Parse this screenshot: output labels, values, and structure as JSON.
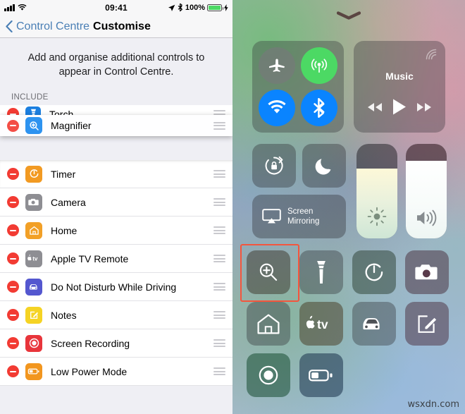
{
  "status_bar": {
    "signal_icon": "cellular-bars-icon",
    "wifi_icon": "wifi-icon",
    "time": "09:41",
    "location_icon": "location-arrow-icon",
    "bluetooth_icon": "bluetooth-icon",
    "battery_percent": "100%",
    "battery_icon": "battery-full-icon",
    "charging_icon": "charging-bolt-icon",
    "battery_color": "#4cd964"
  },
  "nav_bar": {
    "back_icon": "chevron-left-icon",
    "back_label": "Control Centre",
    "title": "Customise",
    "back_color": "#4a7fb5"
  },
  "intro_text": "Add and organise additional controls to appear in Control Centre.",
  "include_section": {
    "header": "INCLUDE",
    "items": [
      {
        "label": "Torch",
        "icon": "torch-icon",
        "icon_color": "#1b7fe0",
        "remove_icon": "minus-circle-icon",
        "reorder_icon": "reorder-grip-icon",
        "state": "static"
      },
      {
        "label": "Magnifier",
        "icon": "magnifier-icon",
        "icon_color": "#2d93f0",
        "remove_icon": "minus-circle-icon",
        "reorder_icon": "reorder-grip-icon",
        "state": "dragging"
      },
      {
        "label": "Timer",
        "icon": "timer-icon",
        "icon_color": "#f29a22",
        "remove_icon": "minus-circle-icon",
        "reorder_icon": "reorder-grip-icon",
        "state": "static"
      },
      {
        "label": "Camera",
        "icon": "camera-icon",
        "icon_color": "#8e8e93",
        "remove_icon": "minus-circle-icon",
        "reorder_icon": "reorder-grip-icon",
        "state": "static"
      },
      {
        "label": "Home",
        "icon": "home-icon",
        "icon_color": "#f2a027",
        "remove_icon": "minus-circle-icon",
        "reorder_icon": "reorder-grip-icon",
        "state": "static"
      },
      {
        "label": "Apple TV Remote",
        "icon": "apple-tv-icon",
        "icon_color": "#8e8e93",
        "remove_icon": "minus-circle-icon",
        "reorder_icon": "reorder-grip-icon",
        "state": "static"
      },
      {
        "label": "Do Not Disturb While Driving",
        "icon": "car-icon",
        "icon_color": "#5457cf",
        "remove_icon": "minus-circle-icon",
        "reorder_icon": "reorder-grip-icon",
        "state": "static"
      },
      {
        "label": "Notes",
        "icon": "notes-icon",
        "icon_color": "#f5d324",
        "remove_icon": "minus-circle-icon",
        "reorder_icon": "reorder-grip-icon",
        "state": "static"
      },
      {
        "label": "Screen Recording",
        "icon": "screen-record-icon",
        "icon_color": "#e8353b",
        "remove_icon": "minus-circle-icon",
        "reorder_icon": "reorder-grip-icon",
        "state": "static"
      },
      {
        "label": "Low Power Mode",
        "icon": "low-power-mode-icon",
        "icon_color": "#f2961f",
        "remove_icon": "minus-circle-icon",
        "reorder_icon": "reorder-grip-icon",
        "state": "static"
      }
    ]
  },
  "control_centre": {
    "handle_icon": "chevron-down-handle-icon",
    "connectivity": {
      "airplane": {
        "icon": "airplane-icon",
        "active": false,
        "color": "#6f6f74"
      },
      "cellular": {
        "icon": "cellular-data-icon",
        "active": true,
        "color": "#4cd964"
      },
      "wifi": {
        "icon": "wifi-icon",
        "active": true,
        "color": "#0a84ff"
      },
      "bluetooth": {
        "icon": "bluetooth-icon",
        "active": true,
        "color": "#0a84ff"
      }
    },
    "music": {
      "title": "Music",
      "airplay_icon": "airplay-audio-icon",
      "rewind_icon": "rewind-icon",
      "play_icon": "play-icon",
      "forward_icon": "fast-forward-icon"
    },
    "rotation_lock": {
      "icon": "rotation-lock-icon"
    },
    "do_not_disturb": {
      "icon": "moon-icon"
    },
    "screen_mirroring": {
      "icon": "screen-mirroring-icon",
      "label": "Screen\nMirroring",
      "label_line1": "Screen",
      "label_line2": "Mirroring"
    },
    "brightness": {
      "icon": "brightness-icon",
      "level_percent": 74
    },
    "volume": {
      "icon": "volume-icon",
      "level_percent": 82
    },
    "shortcuts": [
      {
        "icon": "magnifier-icon",
        "name": "Magnifier",
        "highlighted": true
      },
      {
        "icon": "torch-icon",
        "name": "Torch",
        "highlighted": false
      },
      {
        "icon": "timer-icon",
        "name": "Timer",
        "highlighted": false
      },
      {
        "icon": "camera-icon",
        "name": "Camera",
        "highlighted": false
      },
      {
        "icon": "home-icon",
        "name": "Home",
        "highlighted": false
      },
      {
        "icon": "apple-tv-icon",
        "name": "Apple TV Remote",
        "highlighted": false
      },
      {
        "icon": "car-icon",
        "name": "Do Not Disturb While Driving",
        "highlighted": false
      },
      {
        "icon": "notes-icon",
        "name": "Notes",
        "highlighted": false
      },
      {
        "icon": "screen-record-icon",
        "name": "Screen Recording",
        "highlighted": false
      },
      {
        "icon": "low-power-mode-icon",
        "name": "Low Power Mode",
        "highlighted": false
      }
    ],
    "highlight_color": "#f4553d"
  },
  "watermark": "wsxdn.com"
}
